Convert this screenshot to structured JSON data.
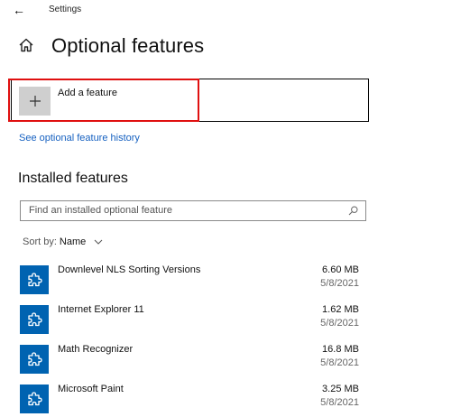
{
  "window": {
    "back_glyph": "←",
    "title": "Settings"
  },
  "page": {
    "title": "Optional features",
    "home_icon": "home-icon"
  },
  "add_feature": {
    "label": "Add a feature",
    "icon": "plus-icon"
  },
  "history_link": "See optional feature history",
  "installed": {
    "title": "Installed features",
    "search_placeholder": "Find an installed optional feature",
    "sort_label": "Sort by:",
    "sort_value": "Name",
    "items": [
      {
        "name": "Downlevel NLS Sorting Versions",
        "size": "6.60 MB",
        "date": "5/8/2021",
        "icon": "puzzle-icon"
      },
      {
        "name": "Internet Explorer 11",
        "size": "1.62 MB",
        "date": "5/8/2021",
        "icon": "puzzle-icon"
      },
      {
        "name": "Math Recognizer",
        "size": "16.8 MB",
        "date": "5/8/2021",
        "icon": "puzzle-icon"
      },
      {
        "name": "Microsoft Paint",
        "size": "3.25 MB",
        "date": "5/8/2021",
        "icon": "puzzle-icon"
      }
    ]
  },
  "colors": {
    "accent": "#0063b1",
    "link": "#1560c0",
    "highlight": "#e01010"
  }
}
